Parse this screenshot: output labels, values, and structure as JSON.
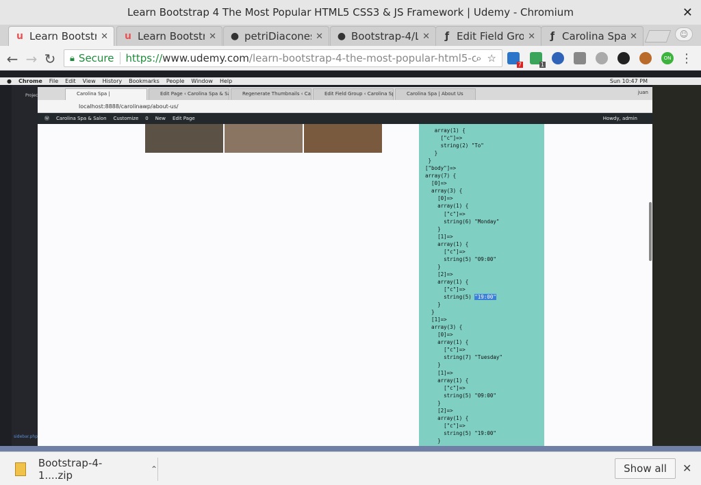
{
  "window": {
    "title": "Learn Bootstrap 4 The Most Popular HTML5 CSS3 & JS Framework | Udemy - Chromium"
  },
  "tabs": [
    {
      "label": "Learn Bootstr",
      "icon": "udemy-icon",
      "active": true
    },
    {
      "label": "Learn Bootstr",
      "icon": "udemy-icon",
      "active": false
    },
    {
      "label": "petriDiacones",
      "icon": "github-icon",
      "active": false
    },
    {
      "label": "Bootstrap-4/L",
      "icon": "github-icon",
      "active": false
    },
    {
      "label": "Edit Field Gro",
      "icon": "wordpress-plugin-icon",
      "active": false
    },
    {
      "label": "Carolina Spa",
      "icon": "wordpress-plugin-icon",
      "active": false
    }
  ],
  "omnibox": {
    "secure_label": "Secure",
    "url_scheme": "https://",
    "url_host": "www.udemy.com",
    "url_path": "/learn-bootstrap-4-the-most-popular-html5-css3-js-"
  },
  "extensions": {
    "badge_a": "7",
    "badge_b": "1",
    "badge_c": "ON"
  },
  "mac_menubar": {
    "items": [
      "Chrome",
      "File",
      "Edit",
      "View",
      "History",
      "Bookmarks",
      "People",
      "Window",
      "Help"
    ],
    "clock": "Sun 10:47 PM"
  },
  "inner_tabs": [
    "Carolina Spa |",
    "Edit Page ‹ Carolina Spa & Sal",
    "Regenerate Thumbnails ‹ Caro",
    "Edit Field Group ‹ Carolina Spa",
    "Carolina Spa | About Us"
  ],
  "inner_user": "juan",
  "inner_url": "localhost:8888/carolinawp/about-us/",
  "wp_admin_bar": {
    "site": "Carolina Spa & Salon",
    "customize": "Customize",
    "comments": "0",
    "new": "New",
    "edit": "Edit Page",
    "howdy": "Howdy, admin"
  },
  "code_lines": [
    "     array(1) {",
    "       [\"c\"]=>",
    "       string(2) \"To\"",
    "     }",
    "   }",
    "  [\"body\"]=>",
    "  array(7) {",
    "    [0]=>",
    "    array(3) {",
    "      [0]=>",
    "      array(1) {",
    "        [\"c\"]=>",
    "        string(6) \"Monday\"",
    "      }",
    "      [1]=>",
    "      array(1) {",
    "        [\"c\"]=>",
    "        string(5) \"09:00\"",
    "      }",
    "      [2]=>",
    "      array(1) {",
    "        [\"c\"]=>",
    "        string(5) \"19:00\"",
    "      }",
    "    }",
    "    [1]=>",
    "    array(3) {",
    "      [0]=>",
    "      array(1) {",
    "        [\"c\"]=>",
    "        string(7) \"Tuesday\"",
    "      }",
    "      [1]=>",
    "      array(1) {",
    "        [\"c\"]=>",
    "        string(5) \"09:00\"",
    "      }",
    "      [2]=>",
    "      array(1) {",
    "        [\"c\"]=>",
    "        string(5) \"19:00\"",
    "      }"
  ],
  "highlighted_text": "\"19:00\"",
  "editor_side": {
    "project_label": "Project",
    "file_label": "sidebar.php"
  },
  "download": {
    "filename": "Bootstrap-4-1....zip",
    "show_all": "Show all"
  },
  "colors": {
    "code_bg": "#7fcfc2",
    "wp_bar": "#23282d",
    "secure_green": "#1e8c3a"
  }
}
